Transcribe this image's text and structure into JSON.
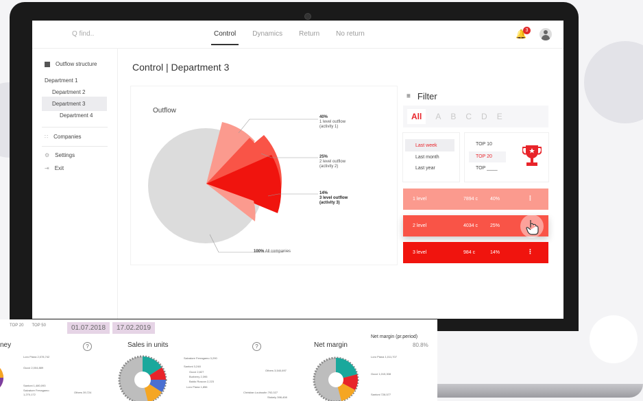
{
  "topbar": {
    "search_placeholder": "Q  find..",
    "tabs": [
      "Control",
      "Dynamics",
      "Return",
      "No return"
    ],
    "notification_count": "3"
  },
  "sidebar": {
    "header": "Outflow structure",
    "departments": [
      "Department 1",
      "Department 2",
      "Department 3",
      "Department 4"
    ],
    "companies": "Companies",
    "settings": "Settings",
    "exit": "Exit"
  },
  "page": {
    "title": "Control  |  Department 3"
  },
  "chart": {
    "title": "Outflow",
    "annotations": [
      {
        "pct": "40%",
        "line1": "1 level outflow",
        "line2": "(activity 1)"
      },
      {
        "pct": "25%",
        "line1": "2 level outflow",
        "line2": "(activity 2)"
      },
      {
        "pct": "14%",
        "line1": "3 level outflow",
        "line2": "(activity 3)"
      }
    ],
    "total_pct": "100%",
    "total_label": "All companies"
  },
  "filter": {
    "title": "Filter",
    "letters": [
      "All",
      "A",
      "B",
      "C",
      "D",
      "E"
    ],
    "periods": [
      "Last week",
      "Last month",
      "Last year"
    ],
    "tops": [
      "TOP 10",
      "TOP 20",
      "TOP ____"
    ]
  },
  "levels": [
    {
      "name": "1 level",
      "count": "7894 c",
      "pct": "40%",
      "color": "#fb9a8e"
    },
    {
      "name": "2 level",
      "count": "4034 c",
      "pct": "25%",
      "color": "#f95447"
    },
    {
      "name": "3 level",
      "count": "984 c",
      "pct": "14%",
      "color": "#f0140e"
    }
  ],
  "overlay": {
    "tabs": [
      "TOP 20",
      "TOP 50"
    ],
    "dates": [
      "01.07.2018",
      "17.02.2019"
    ],
    "titles": [
      "ney",
      "Sales in units",
      "Net margin"
    ],
    "net_margin_label": "Net margin (pr.period)",
    "net_margin_value": "80.8%",
    "money_labels": [
      "Loro Piana 2,078,742",
      "Gucci 2,004,889",
      "Santoni 1,480,093",
      "Salvatore Ferragamo",
      "1,270,172"
    ],
    "units_labels": [
      "Salvatore Ferragamo 3,290",
      "Santoni 3,248",
      "Gucci 2,827",
      "Burberry 2,395",
      "Baldo Ruscon 2,223",
      "Loro Piana 1,856"
    ],
    "units_others": "Others 39,724",
    "margin_labels": [
      "Loro Piana 1,011,707",
      "Gucci 1,015,308",
      "Santoni 728,577"
    ],
    "margin_others": [
      "Others 3,540,697",
      "Christian Louboutin 792,027",
      "Stokely 398,408"
    ]
  },
  "colors": {
    "accent": "#e8242a",
    "pie_base": "#dcdcdc"
  }
}
